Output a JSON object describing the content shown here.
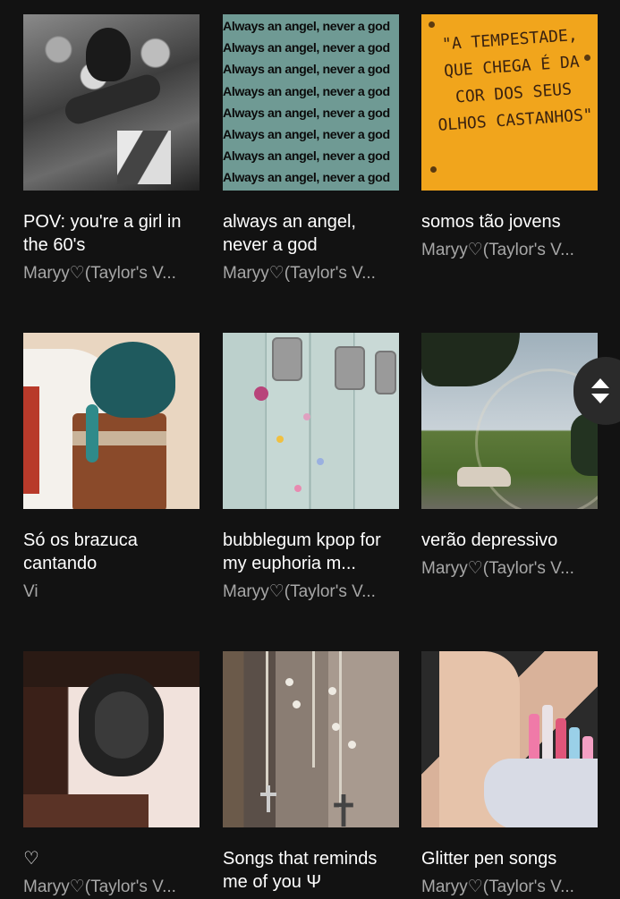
{
  "playlists": [
    {
      "title": "POV: you're a girl in the 60's",
      "owner": "Maryy♡(Taylor's V..."
    },
    {
      "title": "always an angel, never a god",
      "owner": "Maryy♡(Taylor's V..."
    },
    {
      "title": "somos tão jovens",
      "owner": "Maryy♡(Taylor's V..."
    },
    {
      "title": "Só os brazuca cantando",
      "owner": "Vi"
    },
    {
      "title": "bubblegum kpop for my euphoria m...",
      "owner": "Maryy♡(Taylor's V..."
    },
    {
      "title": "verão depressivo",
      "owner": "Maryy♡(Taylor's V..."
    },
    {
      "title": "♡",
      "owner": "Maryy♡(Taylor's V..."
    },
    {
      "title": "Songs that reminds me of you Ψ",
      "owner": ""
    },
    {
      "title": "Glitter pen songs",
      "owner": "Maryy♡(Taylor's V..."
    }
  ],
  "cover_text": {
    "angel_line": "Always an angel, never a god",
    "tempestade": "\"A TEMPESTADE, QUE CHEGA É DA COR DOS SEUS OLHOS CASTANHOS\""
  },
  "scroll_button": {
    "icon": "up-down-arrows-icon"
  }
}
